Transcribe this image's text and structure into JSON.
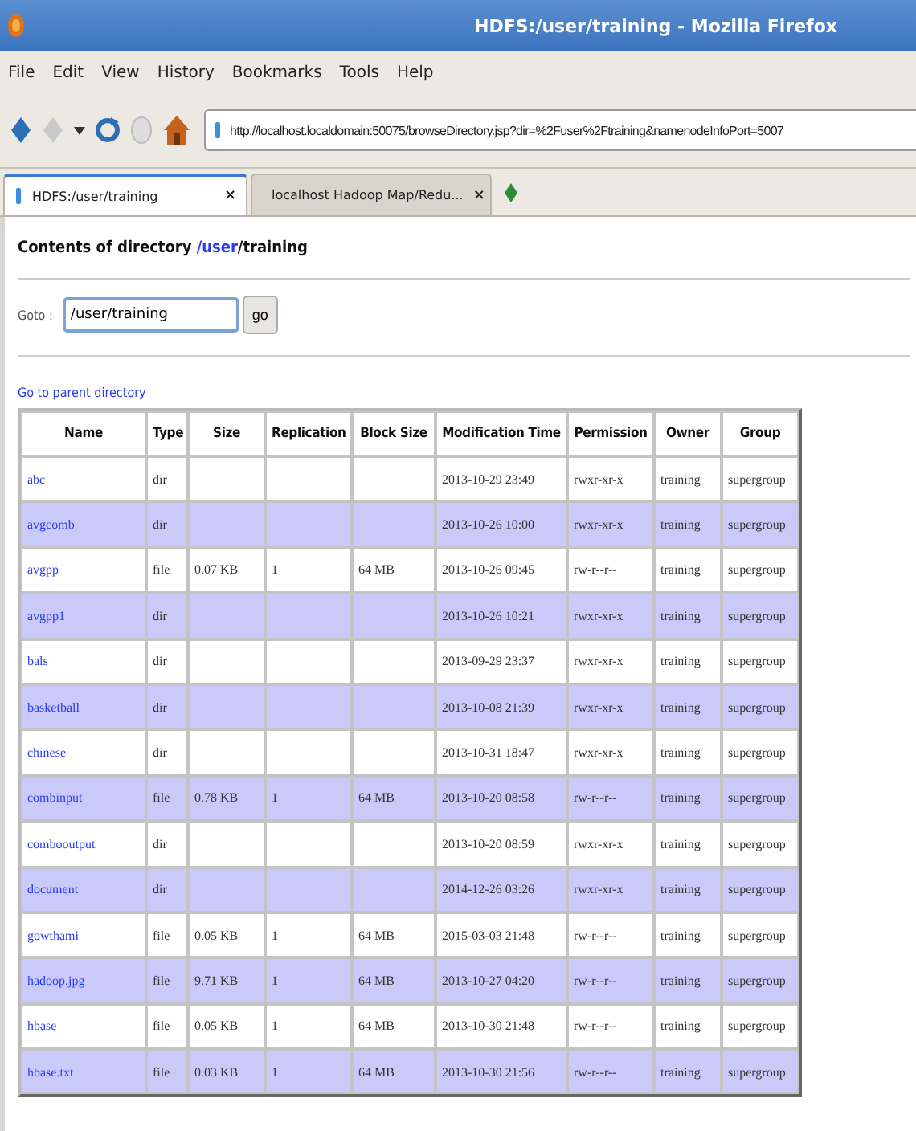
{
  "window": {
    "title": "HDFS:/user/training - Mozilla Firefox"
  },
  "menu": [
    "File",
    "Edit",
    "View",
    "History",
    "Bookmarks",
    "Tools",
    "Help"
  ],
  "address_bar": {
    "value": "http://localhost.localdomain:50075/browseDirectory.jsp?dir=%2Fuser%2Ftraining&namenodeInfoPort=5007"
  },
  "tabs": [
    {
      "label": "HDFS:/user/training",
      "selected": true,
      "close": "×"
    },
    {
      "label": "localhost Hadoop Map/Redu...",
      "selected": false,
      "close": "×"
    }
  ],
  "page": {
    "heading_prefix": "Contents of directory ",
    "heading_link": "/user",
    "heading_rest": "/training",
    "goto_label": "Goto :",
    "goto_value": "/user/training",
    "go_button": "go",
    "parent_link": "Go to parent directory"
  },
  "table": {
    "columns": [
      "Name",
      "Type",
      "Size",
      "Replication",
      "Block Size",
      "Modification Time",
      "Permission",
      "Owner",
      "Group"
    ],
    "rows": [
      [
        "abc",
        "dir",
        "",
        "",
        "",
        "2013-10-29 23:49",
        "rwxr-xr-x",
        "training",
        "supergroup"
      ],
      [
        "avgcomb",
        "dir",
        "",
        "",
        "",
        "2013-10-26 10:00",
        "rwxr-xr-x",
        "training",
        "supergroup"
      ],
      [
        "avgpp",
        "file",
        "0.07 KB",
        "1",
        "64 MB",
        "2013-10-26 09:45",
        "rw-r--r--",
        "training",
        "supergroup"
      ],
      [
        "avgpp1",
        "dir",
        "",
        "",
        "",
        "2013-10-26 10:21",
        "rwxr-xr-x",
        "training",
        "supergroup"
      ],
      [
        "bals",
        "dir",
        "",
        "",
        "",
        "2013-09-29 23:37",
        "rwxr-xr-x",
        "training",
        "supergroup"
      ],
      [
        "basketball",
        "dir",
        "",
        "",
        "",
        "2013-10-08 21:39",
        "rwxr-xr-x",
        "training",
        "supergroup"
      ],
      [
        "chinese",
        "dir",
        "",
        "",
        "",
        "2013-10-31 18:47",
        "rwxr-xr-x",
        "training",
        "supergroup"
      ],
      [
        "combinput",
        "file",
        "0.78 KB",
        "1",
        "64 MB",
        "2013-10-20 08:58",
        "rw-r--r--",
        "training",
        "supergroup"
      ],
      [
        "combooutput",
        "dir",
        "",
        "",
        "",
        "2013-10-20 08:59",
        "rwxr-xr-x",
        "training",
        "supergroup"
      ],
      [
        "document",
        "dir",
        "",
        "",
        "",
        "2014-12-26 03:26",
        "rwxr-xr-x",
        "training",
        "supergroup"
      ],
      [
        "gowthami",
        "file",
        "0.05 KB",
        "1",
        "64 MB",
        "2015-03-03 21:48",
        "rw-r--r--",
        "training",
        "supergroup"
      ],
      [
        "hadoop.jpg",
        "file",
        "9.71 KB",
        "1",
        "64 MB",
        "2013-10-27 04:20",
        "rw-r--r--",
        "training",
        "supergroup"
      ],
      [
        "hbase",
        "file",
        "0.05 KB",
        "1",
        "64 MB",
        "2013-10-30 21:48",
        "rw-r--r--",
        "training",
        "supergroup"
      ],
      [
        "hbase.txt",
        "file",
        "0.03 KB",
        "1",
        "64 MB",
        "2013-10-30 21:56",
        "rw-r--r--",
        "training",
        "supergroup"
      ]
    ]
  }
}
